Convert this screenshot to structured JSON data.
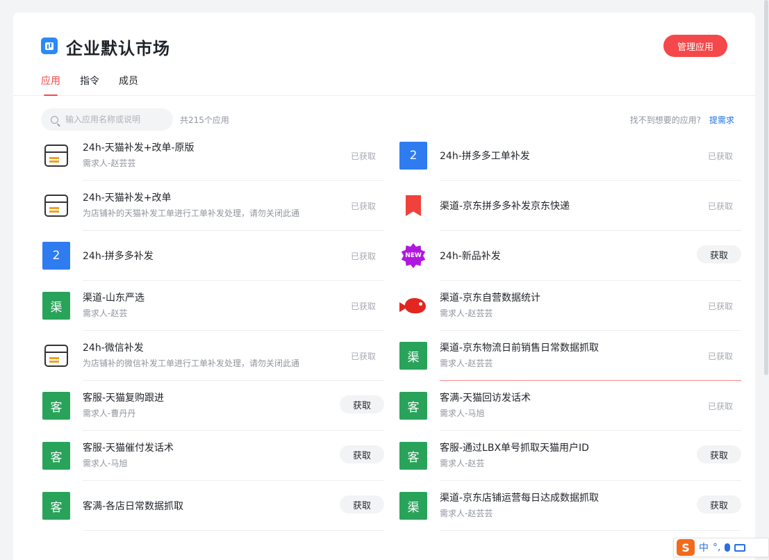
{
  "header": {
    "title": "企业默认市场",
    "manage_label": "管理应用",
    "tabs": [
      {
        "label": "应用",
        "active": true
      },
      {
        "label": "指令",
        "active": false
      },
      {
        "label": "成员",
        "active": false
      }
    ]
  },
  "toolbar": {
    "search_placeholder": "输入应用名称或说明",
    "count_text": "共215个应用",
    "missing_text": "找不到想要的应用?",
    "request_label": "提需求"
  },
  "colors": {
    "accent": "#f5484a",
    "link": "#1f6fe5",
    "icon_green": "#29a35a",
    "icon_blue": "#2e7cf0"
  },
  "labels": {
    "obtained": "已获取",
    "get": "获取"
  },
  "apps_left": [
    {
      "icon": "box-icon",
      "name": "24h-天猫补发+改单-原版",
      "desc": "需求人-赵芸芸",
      "state": "obtained"
    },
    {
      "icon": "box-icon",
      "name": "24h-天猫补发+改单",
      "desc": "为店铺补的天猫补发工单进行工单补发处理，请勿关闭此通",
      "state": "obtained"
    },
    {
      "icon": "number-icon",
      "icon_text": "2",
      "name": "24h-拼多多补发",
      "desc": "",
      "state": "obtained"
    },
    {
      "icon": "green-icon",
      "icon_text": "渠",
      "name": "渠道-山东严选",
      "desc": "需求人-赵芸",
      "state": "obtained"
    },
    {
      "icon": "box-icon",
      "name": "24h-微信补发",
      "desc": "为店铺补的微信补发工单进行工单补发处理，请勿关闭此通",
      "state": "obtained"
    },
    {
      "icon": "green-icon",
      "icon_text": "客",
      "name": "客服-天猫复购跟进",
      "desc": "需求人-曹丹丹",
      "state": "get"
    },
    {
      "icon": "green-icon",
      "icon_text": "客",
      "name": "客服-天猫催付发话术",
      "desc": "需求人-马旭",
      "state": "get"
    },
    {
      "icon": "green-icon",
      "icon_text": "客",
      "name": "客满-各店日常数据抓取",
      "desc": "",
      "state": "get"
    }
  ],
  "apps_right": [
    {
      "icon": "number-icon",
      "icon_text": "2",
      "name": "24h-拼多多工单补发",
      "desc": "",
      "state": "obtained"
    },
    {
      "icon": "bookmark-icon",
      "name": "渠道-京东拼多多补发京东快递",
      "desc": "",
      "state": "obtained"
    },
    {
      "icon": "new-badge-icon",
      "icon_text": "NEW",
      "name": "24h-新品补发",
      "desc": "",
      "state": "get"
    },
    {
      "icon": "fish-icon",
      "name": "渠道-京东自营数据统计",
      "desc": "需求人-赵芸芸",
      "state": "obtained"
    },
    {
      "icon": "green-icon",
      "icon_text": "渠",
      "name": "渠道-京东物流日前销售日常数据抓取",
      "desc": "需求人-赵芸芸",
      "state": "obtained"
    },
    {
      "icon": "green-icon",
      "icon_text": "客",
      "name": "客满-天猫回访发话术",
      "desc": "需求人-马旭",
      "state": "obtained"
    },
    {
      "icon": "green-icon",
      "icon_text": "客",
      "name": "客服-通过LBX单号抓取天猫用户ID",
      "desc": "需求人-赵芸",
      "state": "get"
    },
    {
      "icon": "green-icon",
      "icon_text": "渠",
      "name": "渠道-京东店铺运营每日达成数据抓取",
      "desc": "需求人-赵芸芸",
      "state": "get"
    }
  ],
  "ime": {
    "logo": "S",
    "lang": "中"
  }
}
